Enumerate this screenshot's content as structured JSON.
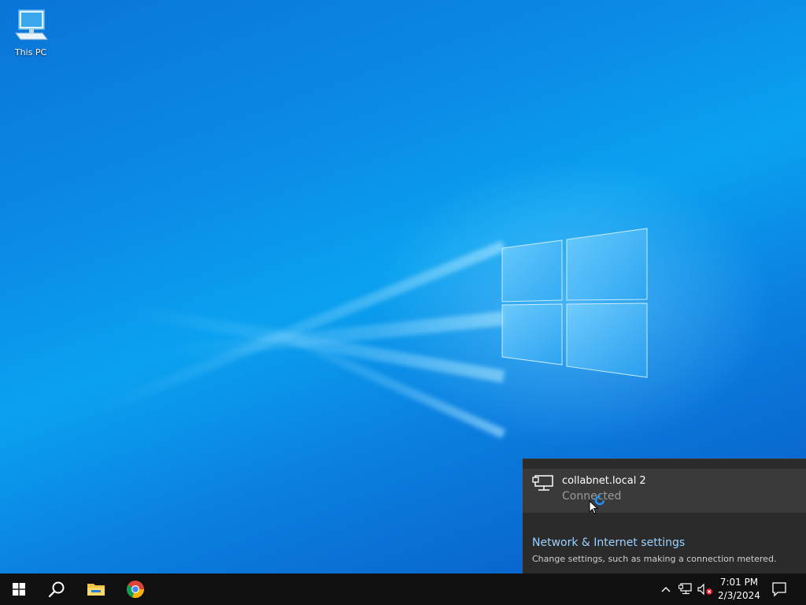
{
  "desktop": {
    "icons": [
      {
        "label": "This PC",
        "icon": "computer-icon"
      }
    ]
  },
  "flyout": {
    "network": {
      "name": "collabnet.local 2",
      "status": "Connected",
      "icon": "ethernet-icon"
    },
    "settings_link": "Network & Internet settings",
    "settings_description": "Change settings, such as making a connection metered."
  },
  "taskbar": {
    "apps": [
      {
        "name": "start",
        "icon": "windows-icon"
      },
      {
        "name": "search",
        "icon": "search-icon"
      },
      {
        "name": "file-explorer",
        "icon": "folder-icon"
      },
      {
        "name": "chrome",
        "icon": "chrome-icon"
      }
    ],
    "tray": {
      "icons": [
        "chevron-up-icon",
        "network-icon",
        "volume-muted-icon"
      ],
      "time": "7:01 PM",
      "date": "2/3/2024"
    }
  },
  "colors": {
    "accent_link": "#9cd0ff",
    "flyout_bg": "#2b2b2b",
    "taskbar_bg": "#101010"
  }
}
